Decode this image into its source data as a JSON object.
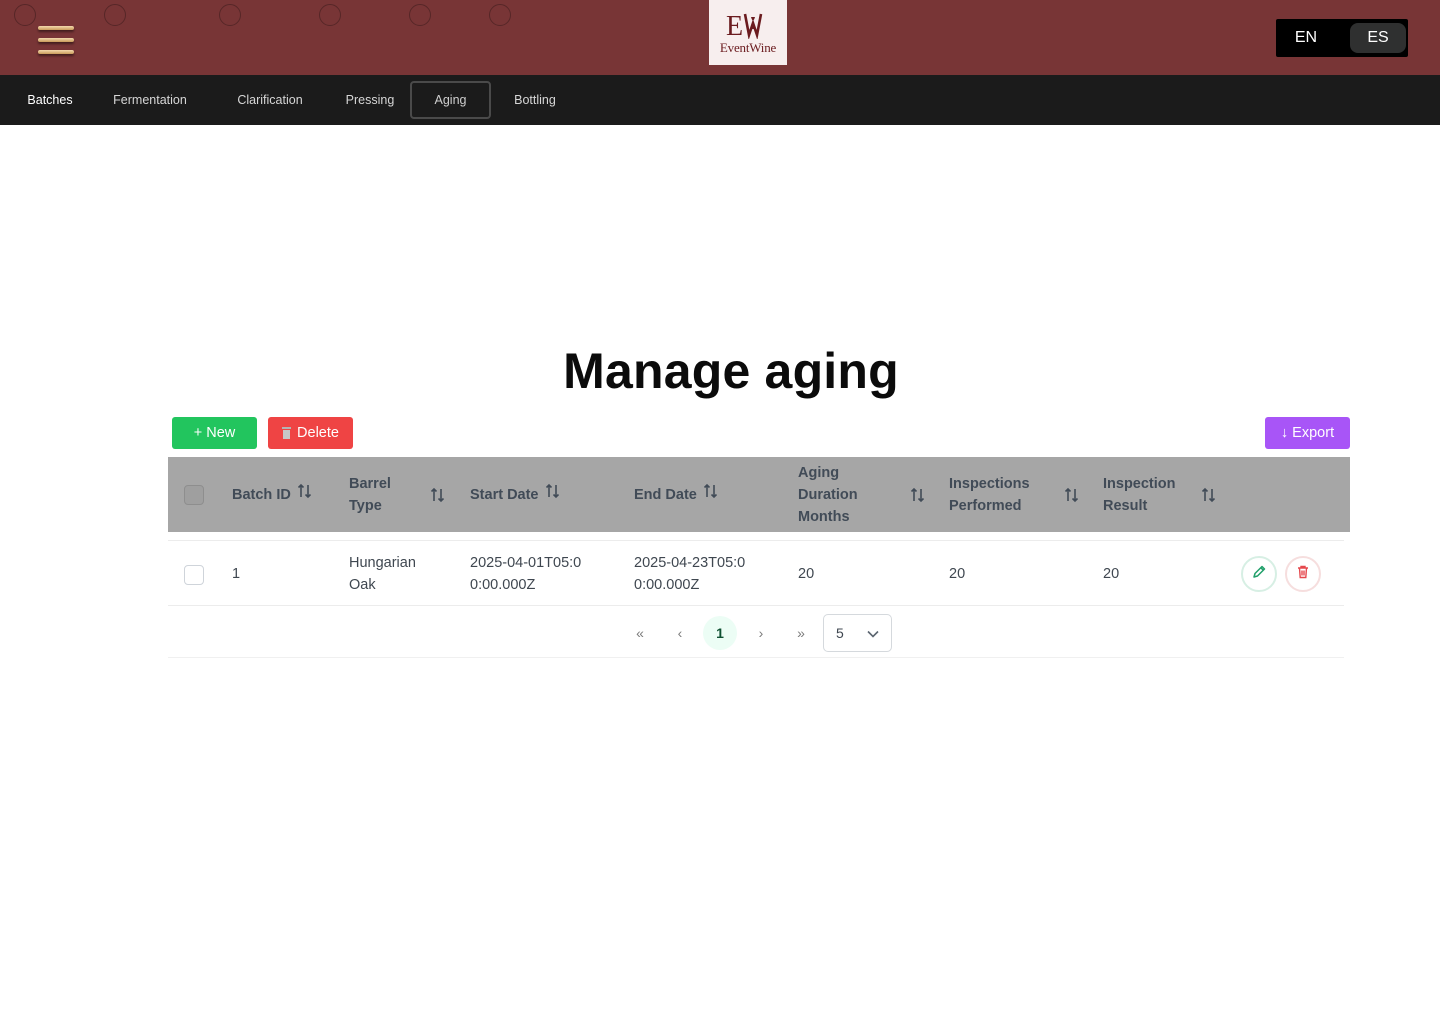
{
  "brand": {
    "logo_text": "EventWine",
    "logo_mark": "EW"
  },
  "language": {
    "options": [
      "EN",
      "ES"
    ],
    "selected": "ES"
  },
  "tabs": [
    {
      "label": "Batches"
    },
    {
      "label": "Fermentation"
    },
    {
      "label": "Clarification"
    },
    {
      "label": "Pressing"
    },
    {
      "label": "Aging"
    },
    {
      "label": "Bottling"
    }
  ],
  "active_tab": "Aging",
  "page": {
    "title": "Manage aging"
  },
  "toolbar": {
    "new_label": "+ New",
    "delete_label": "Delete",
    "export_label": "↓ Export"
  },
  "table": {
    "columns": [
      {
        "label": "Batch ID"
      },
      {
        "label": "Barrel Type"
      },
      {
        "label": "Start Date"
      },
      {
        "label": "End Date"
      },
      {
        "label": "Aging Duration Months"
      },
      {
        "label": "Inspections Performed"
      },
      {
        "label": "Inspection Result"
      }
    ],
    "rows": [
      {
        "batch_id": "1",
        "barrel_type": "Hungarian Oak",
        "start_date": "2025-04-01T05:00:00.000Z",
        "end_date": "2025-04-23T05:00:00.000Z",
        "aging_duration_months": "20",
        "inspections_performed": "20",
        "inspection_result": "20"
      }
    ]
  },
  "paginator": {
    "first": "«",
    "prev": "‹",
    "current_page": "1",
    "next": "›",
    "last": "»",
    "rows_per_page": "5"
  },
  "colors": {
    "header": "#783536",
    "nav": "#1b1b1b",
    "new": "#22c55e",
    "delete": "#ef4444",
    "export": "#a855f7",
    "table_header": "#a6a6a6"
  },
  "icons": [
    "menu-icon",
    "sort-icon",
    "edit-icon",
    "trash-icon",
    "chevron-down-icon"
  ]
}
